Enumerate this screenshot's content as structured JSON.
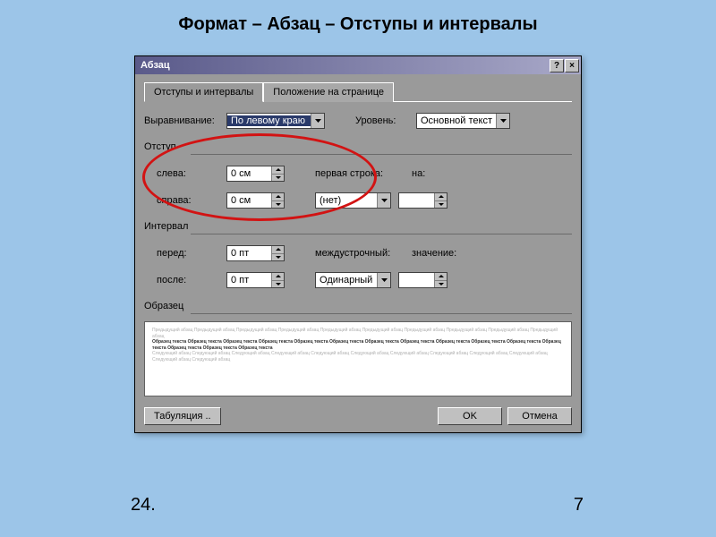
{
  "page": {
    "heading": "Формат – Абзац – Отступы и интервалы",
    "footnote_left": "24.",
    "footnote_right": "7"
  },
  "dialog": {
    "title": "Абзац",
    "help_btn": "?",
    "close_btn": "×",
    "tabs": {
      "active": "Отступы и интервалы",
      "second": "Положение на странице"
    },
    "alignment": {
      "label": "Выравнивание:",
      "value": "По левому краю"
    },
    "level": {
      "label": "Уровень:",
      "value": "Основной текст"
    },
    "indent": {
      "group": "Отступ",
      "left_label": "слева:",
      "left_value": "0 см",
      "right_label": "справа:",
      "right_value": "0 см",
      "firstline_label": "первая строка:",
      "firstline_value": "(нет)",
      "by_label": "на:",
      "by_value": ""
    },
    "spacing": {
      "group": "Интервал",
      "before_label": "перед:",
      "before_value": "0 пт",
      "after_label": "после:",
      "after_value": "0 пт",
      "line_label": "междустрочный:",
      "line_value": "Одинарный",
      "at_label": "значение:",
      "at_value": ""
    },
    "preview": {
      "label": "Образец",
      "text_light1": "Предыдущий абзац Предыдущий абзац Предыдущий абзац Предыдущий абзац Предыдущий абзац Предыдущий абзац Предыдущий абзац Предыдущий абзац Предыдущий абзац Предыдущий абзац",
      "text_dark": "Образец текста Образец текста Образец текста Образец текста Образец текста Образец текста Образец текста Образец текста Образец текста Образец текста Образец текста Образец текста Образец текста Образец текста Образец текста",
      "text_light2": "Следующий абзац Следующий абзац Следующий абзац Следующий абзац Следующий абзац Следующий абзац Следующий абзац Следующий абзац Следующий абзац Следующий абзац Следующий абзац Следующий абзац"
    },
    "buttons": {
      "tabulation": "Табуляция ..",
      "ok": "OK",
      "cancel": "Отмена"
    }
  }
}
